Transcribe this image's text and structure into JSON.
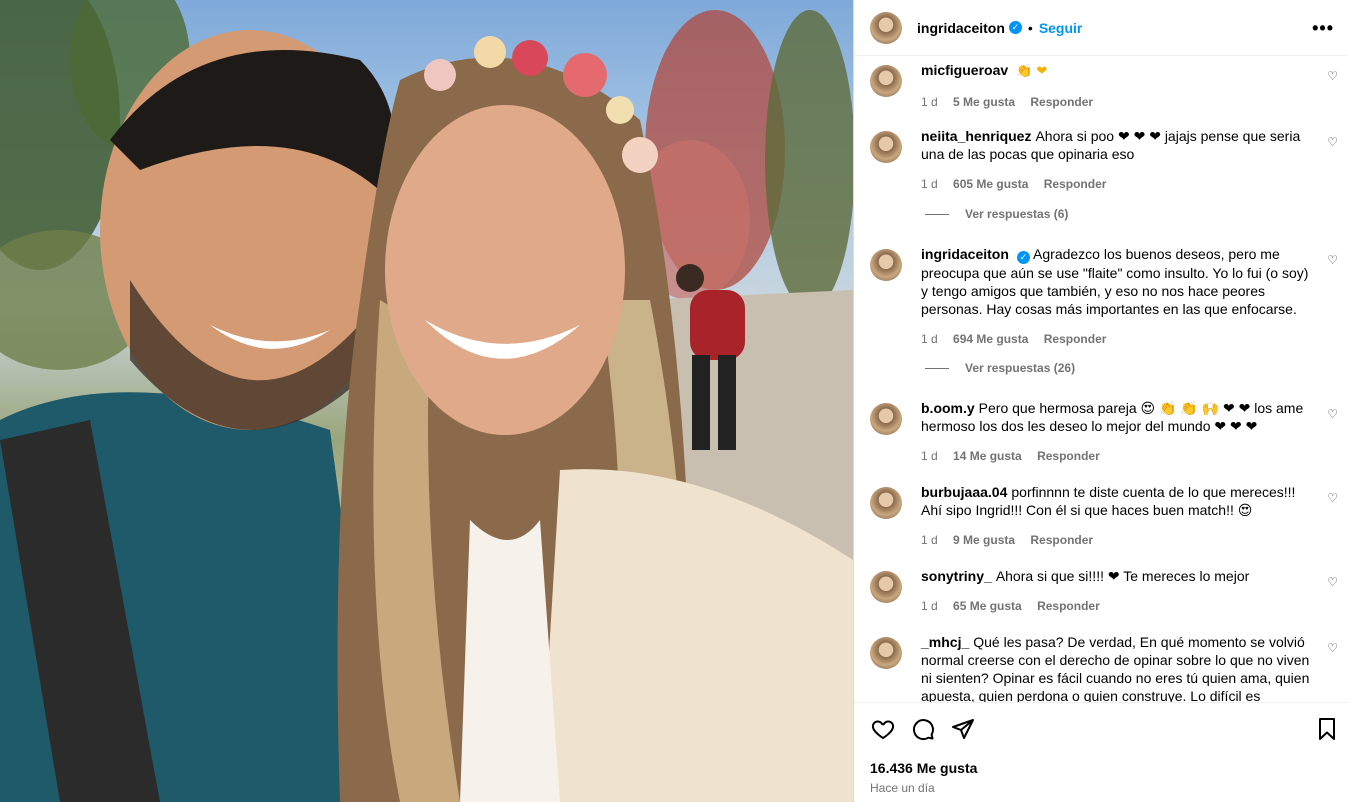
{
  "header": {
    "username": "ingridaceiton",
    "separator": "•",
    "follow_label": "Seguir",
    "more_label": "•••"
  },
  "comments": [
    {
      "user": "micfigueroav",
      "text": "",
      "emoji": "👏 ❤",
      "time": "1 d",
      "likes": "5 Me gusta",
      "reply": "Responder"
    },
    {
      "user": "neiita_henriquez",
      "text": "Ahora si poo ❤ ❤ ❤ jajajs pense que seria una de las pocas que opinaria eso",
      "time": "1 d",
      "likes": "605 Me gusta",
      "reply": "Responder",
      "view_replies": "Ver respuestas (6)"
    },
    {
      "user": "ingridaceiton",
      "text": "Agradezco los buenos deseos, pero me preocupa que aún se use \"flaite\" como insulto. Yo lo fui (o soy) y tengo amigos que también, y eso no nos hace peores personas. Hay cosas más importantes en las que enfocarse.",
      "time": "1 d",
      "likes": "694 Me gusta",
      "reply": "Responder",
      "view_replies": "Ver respuestas (26)"
    },
    {
      "user": "b.oom.y",
      "text": "Pero que hermosa pareja 😍 👏 👏 🙌 ❤ ❤ los ame hermoso los dos les deseo lo mejor del mundo ❤ ❤ ❤",
      "time": "1 d",
      "likes": "14 Me gusta",
      "reply": "Responder"
    },
    {
      "user": "burbujaaa.04",
      "text": "porfinnnn te diste cuenta de lo que mereces!!! Ahí sipo Ingrid!!! Con él si que haces buen match!! 😍",
      "time": "1 d",
      "likes": "9 Me gusta",
      "reply": "Responder"
    },
    {
      "user": "sonytriny_",
      "text": "Ahora si que si!!!! ❤ Te mereces lo mejor",
      "time": "1 d",
      "likes": "65 Me gusta",
      "reply": "Responder"
    },
    {
      "user": "_mhcj_",
      "text": "Qué les pasa? De verdad, En qué momento se volvió normal creerse con el derecho de opinar sobre lo que no viven ni sienten? Opinar es fácil cuando no eres tú quien ama, quien apuesta, quien perdona o quien construye. Lo difícil es"
    }
  ],
  "footer": {
    "likes": "16.436 Me gusta",
    "time": "Hace un día"
  },
  "icons": {
    "like": "heart-icon",
    "comment": "comment-icon",
    "share": "share-icon",
    "save": "bookmark-icon"
  },
  "colors": {
    "accent": "#0095f6",
    "verified": "#0095f6",
    "muted": "#737373",
    "heart": "#ed4956"
  }
}
